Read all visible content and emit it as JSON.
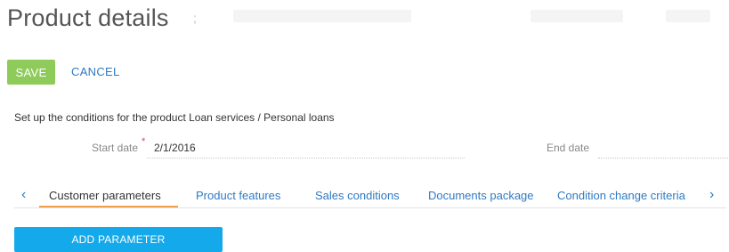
{
  "page": {
    "title": "Product details"
  },
  "toolbar": {
    "save_label": "SAVE",
    "cancel_label": "CANCEL"
  },
  "conditions": {
    "description": "Set up the conditions for the product Loan services / Personal loans"
  },
  "fields": {
    "start_date": {
      "label": "Start date",
      "required_marker": "*",
      "value": "2/1/2016"
    },
    "end_date": {
      "label": "End date",
      "value": ""
    }
  },
  "tabs": {
    "prev_glyph": "‹",
    "next_glyph": "›",
    "items": [
      {
        "label": "Customer parameters",
        "active": true
      },
      {
        "label": "Product features",
        "active": false
      },
      {
        "label": "Sales conditions",
        "active": false
      },
      {
        "label": "Documents package",
        "active": false
      },
      {
        "label": "Condition change criteria",
        "active": false
      }
    ]
  },
  "actions": {
    "add_parameter_label": "ADD PARAMETER"
  },
  "colors": {
    "save_button": "#8ecb5b",
    "link": "#2f7ac3",
    "active_tab_underline": "#f29f4b",
    "add_button": "#13a9ea",
    "required": "#e0454b"
  }
}
